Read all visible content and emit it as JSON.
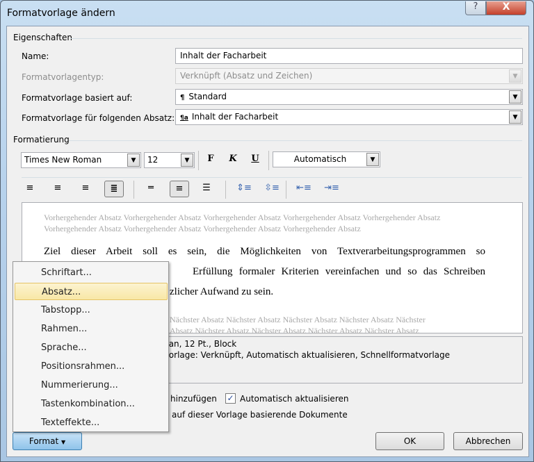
{
  "window": {
    "title": "Formatvorlage ändern",
    "help": "?",
    "close": "X"
  },
  "properties": {
    "heading": "Eigenschaften",
    "name_label": "Name:",
    "name_value": "Inhalt der Facharbeit",
    "type_label": "Formatvorlagentyp:",
    "type_value": "Verknüpft (Absatz und Zeichen)",
    "based_label": "Formatvorlage basiert auf:",
    "based_icon": "¶",
    "based_value": "Standard",
    "next_label": "Formatvorlage für folgenden Absatz:",
    "next_icon": "¶a",
    "next_value": "Inhalt der Facharbeit"
  },
  "formatting": {
    "heading": "Formatierung",
    "font": "Times New Roman",
    "size": "12",
    "bold": "F",
    "italic": "K",
    "underline": "U",
    "color": "Automatisch"
  },
  "preview": {
    "previous": "Vorhergehender Absatz Vorhergehender Absatz Vorhergehender Absatz Vorhergehender Absatz Vorhergehender Absatz Vorhergehender Absatz Vorhergehender Absatz Vorhergehender Absatz Vorhergehender Absatz",
    "line1": "Ziel dieser Arbeit soll es sein, die Möglichkeiten von Textverarbeitungsprogrammen so",
    "line2": "Erfüllung formaler Kriterien vereinfachen und so das Schreiben",
    "line3": "zlicher Aufwand zu sein.",
    "next1": "Nächster Absatz Nächster Absatz Nächster Absatz Nächster Absatz Nächster",
    "next2": "Absatz Nächster Absatz Nächster Absatz Nächster Absatz Nächster Absatz"
  },
  "description": {
    "line1": "man, 12 Pt., Block",
    "line2": "tvorlage: Verknüpft, Automatisch aktualisieren, Schnellformatvorlage"
  },
  "options": {
    "add_fragment": "hinzufügen",
    "auto_update": "Automatisch aktualisieren",
    "auto_update_checked": true,
    "docs_fragment": "auf dieser Vorlage basierende Dokumente"
  },
  "buttons": {
    "format": "Format",
    "ok": "OK",
    "cancel": "Abbrechen"
  },
  "menu": {
    "items": [
      "Schriftart...",
      "Absatz...",
      "Tabstopp...",
      "Rahmen...",
      "Sprache...",
      "Positionsrahmen...",
      "Nummerierung...",
      "Tastenkombination...",
      "Texteffekte..."
    ],
    "highlighted": "Absatz..."
  }
}
